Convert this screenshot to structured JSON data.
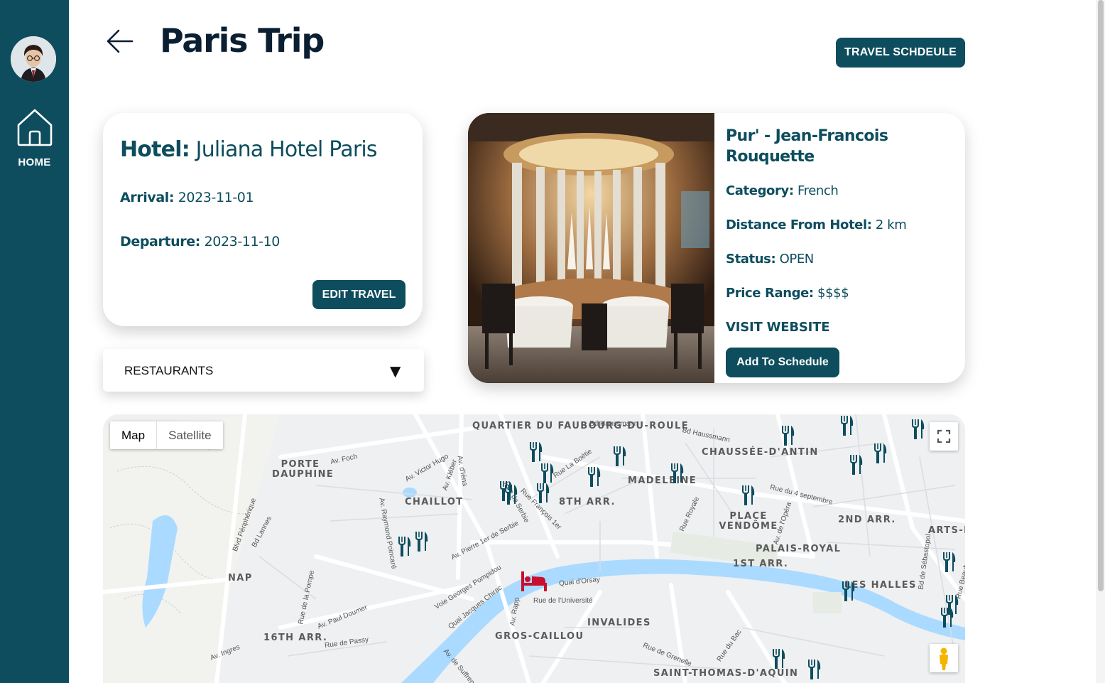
{
  "app": {
    "page_title": "Paris Trip",
    "schedule_button": "TRAVEL SCHDEULE"
  },
  "sidebar": {
    "home_label": "HOME"
  },
  "hotel": {
    "label": "Hotel",
    "name": "Juliana Hotel Paris",
    "arrival_label": "Arrival",
    "arrival": "2023-11-01",
    "departure_label": "Departure",
    "departure": "2023-11-10",
    "edit_button": "EDIT TRAVEL"
  },
  "category_dropdown": {
    "selected": "RESTAURANTS",
    "caret": "▼"
  },
  "restaurant": {
    "name": "Pur' - Jean-Francois Rouquette",
    "category_label": "Category",
    "category": "French",
    "distance_label": "Distance From Hotel",
    "distance": "2 km",
    "status_label": "Status",
    "status": "OPEN",
    "price_label": "Price Range",
    "price": "$$$$",
    "website_link": "VISIT WEBSITE",
    "add_button": "Add To Schedule"
  },
  "map": {
    "tabs": [
      "Map",
      "Satellite"
    ],
    "active_tab": "Map",
    "districts": [
      "QUARTIER DU FAUBOURG-DU-ROULE",
      "PORTE DAUPHINE",
      "CHAILLOT",
      "8TH ARR.",
      "MADELEINE",
      "CHAUSSÉE-D'ANTIN",
      "PLACE VENDÔME",
      "2ND ARR.",
      "PALAIS-ROYAL",
      "1ST ARR.",
      "ARTS-E",
      "LES HALLES",
      "NAP",
      "16TH ARR.",
      "GROS-CAILLOU",
      "INVALIDES",
      "SAINT-THOMAS-D'AQUIN"
    ],
    "streets": [
      "Bd Haussmann",
      "Bd Haussmann",
      "Av. Foch",
      "Av. Victor Hugo",
      "Av. Kléber",
      "Av. d'Iéna",
      "Rue La Boétie",
      "Rue du 4 septembre",
      "Rue Royale",
      "Av. de l'Opéra",
      "Av. Raymond Poincaré",
      "Rue François 1er",
      "Rue de Serbie",
      "Av. Pierre 1er de Serbie",
      "Voie Georges Pompidou",
      "Quai d'Orsay",
      "Rue de l'Université",
      "Quai Jacques Chirac",
      "Av. Rapp",
      "Av. Paul Doumer",
      "Rue de la Pompe",
      "Rue de Passy",
      "Av. Ingres",
      "Rue de Grenelle",
      "Rue du Bac",
      "Bd de Sébastopol",
      "Rue Beaubourg",
      "Bd Lannes",
      "Blvd Périphérique",
      "Av. de Suffren"
    ],
    "icons": {
      "restaurant": "fork-knife-icon",
      "hotel": "bed-icon",
      "fullscreen": "fullscreen-icon",
      "street_view": "pegman-icon"
    }
  },
  "colors": {
    "primary": "#0d4d5e",
    "title": "#0b1f33",
    "water": "#aadaff",
    "hotel_pin": "#c8102e"
  }
}
